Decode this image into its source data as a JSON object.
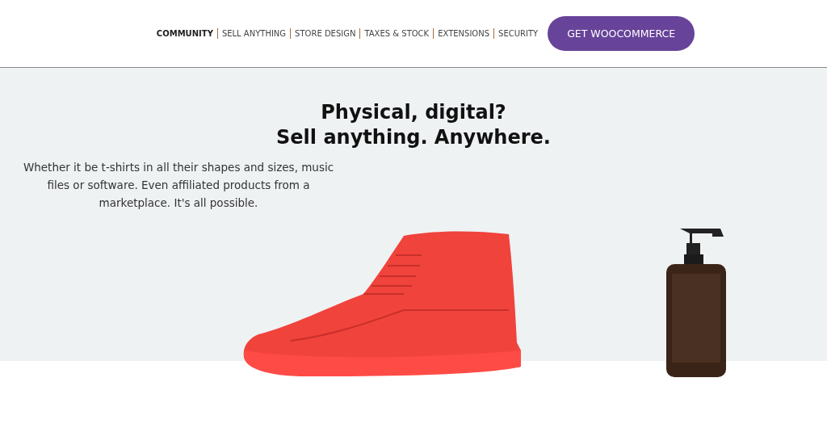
{
  "nav": {
    "items": [
      {
        "label": "COMMUNITY",
        "selected": true
      },
      {
        "label": "SELL ANYTHING",
        "selected": false
      },
      {
        "label": "STORE DESIGN",
        "selected": false
      },
      {
        "label": "TAXES & STOCK",
        "selected": false
      },
      {
        "label": "EXTENSIONS",
        "selected": false
      },
      {
        "label": "SECURITY",
        "selected": false
      }
    ],
    "cta": "GET WOOCOMMERCE"
  },
  "hero": {
    "title_lines": [
      "Physical, digital?",
      "Sell anything. Anywhere."
    ],
    "body": "Whether it be t-shirts in all their shapes and sizes, music files or software. Even affiliated products from a marketplace. It's all possible."
  }
}
